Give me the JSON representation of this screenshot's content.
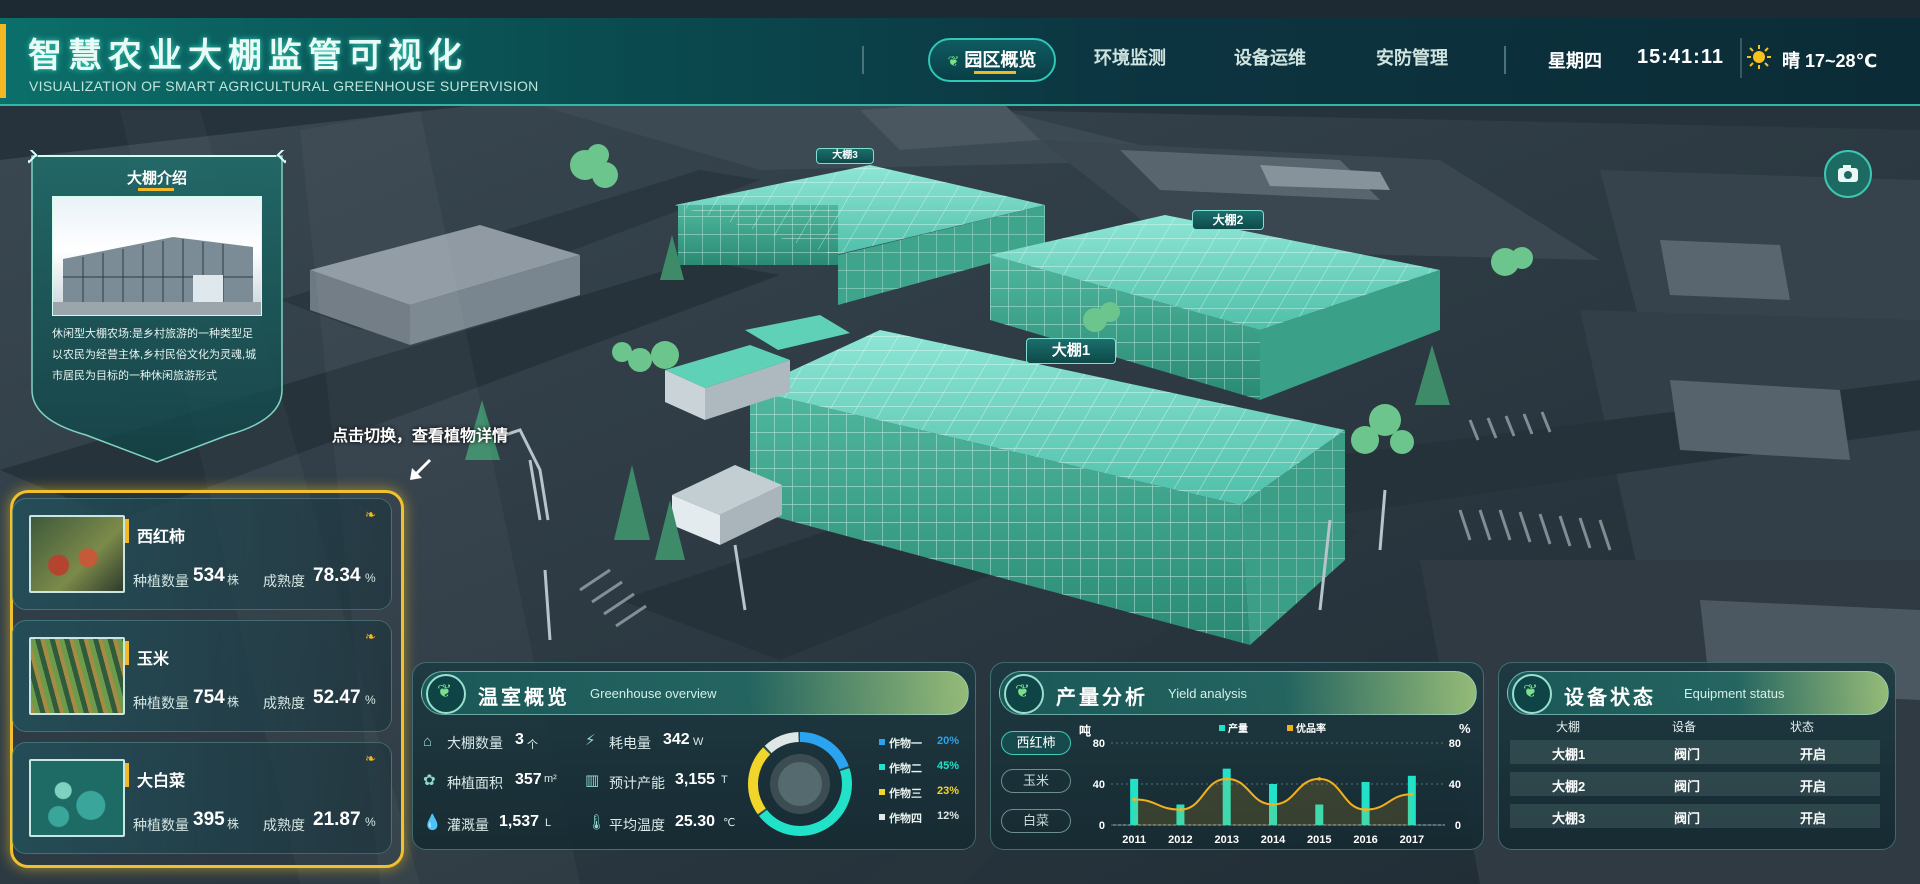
{
  "header": {
    "title": "智慧农业大棚监管可视化",
    "subtitle": "VISUALIZATION OF SMART AGRICULTURAL GREENHOUSE SUPERVISION",
    "nav": [
      {
        "label": "园区概览",
        "active": true
      },
      {
        "label": "环境监测",
        "active": false
      },
      {
        "label": "设备运维",
        "active": false
      },
      {
        "label": "安防管理",
        "active": false
      }
    ],
    "weekday": "星期四",
    "time": "15:41:11",
    "weather": "晴 17~28℃"
  },
  "intro": {
    "title": "大棚介绍",
    "text": "休闲型大棚农场:是乡村旅游的一种类型足以农民为经营主体,乡村民俗文化为灵魂,城市居民为目标的一种休闲旅游形式"
  },
  "hint": "点击切换，查看植物详情",
  "greenhouse_tags": [
    "大棚1",
    "大棚2",
    "大棚3"
  ],
  "crops": [
    {
      "name": "西红柿",
      "count_label": "种植数量",
      "count": "534",
      "count_unit": "株",
      "ripe_label": "成熟度",
      "ripe": "78.34",
      "ripe_unit": "%",
      "colors": [
        "#3e5a3a",
        "#b3452f",
        "#7c8a4a"
      ]
    },
    {
      "name": "玉米",
      "count_label": "种植数量",
      "count": "754",
      "count_unit": "株",
      "ripe_label": "成熟度",
      "ripe": "52.47",
      "ripe_unit": "%",
      "colors": [
        "#2f5a3c",
        "#a58b43",
        "#6d9b4c"
      ]
    },
    {
      "name": "大白菜",
      "count_label": "种植数量",
      "count": "395",
      "count_unit": "株",
      "ripe_label": "成熟度",
      "ripe": "21.87",
      "ripe_unit": "%",
      "colors": [
        "#1e6b66",
        "#3aa59a",
        "#7fd1c1"
      ]
    }
  ],
  "overview": {
    "title": "温室概览",
    "title_en": "Greenhouse overview",
    "stats": [
      {
        "label": "大棚数量",
        "value": "3",
        "unit": "个",
        "icon": "house-icon"
      },
      {
        "label": "耗电量",
        "value": "342",
        "unit": "W",
        "icon": "lightning-icon"
      },
      {
        "label": "种植面积",
        "value": "357",
        "unit": "m²",
        "icon": "sprout-icon"
      },
      {
        "label": "预计产能",
        "value": "3,155",
        "unit": "T",
        "icon": "factory-icon"
      },
      {
        "label": "灌溉量",
        "value": "1,537",
        "unit": "L",
        "icon": "water-drop-icon"
      },
      {
        "label": "平均温度",
        "value": "25.30",
        "unit": "℃",
        "icon": "thermometer-icon"
      }
    ],
    "donut": [
      {
        "name": "作物一",
        "pct": "20%",
        "value": 20,
        "color": "#2aa3f0"
      },
      {
        "name": "作物二",
        "pct": "45%",
        "value": 45,
        "color": "#21e1c8"
      },
      {
        "name": "作物三",
        "pct": "23%",
        "value": 23,
        "color": "#f2d52b"
      },
      {
        "name": "作物四",
        "pct": "12%",
        "value": 12,
        "color": "#dfe7e6"
      }
    ]
  },
  "yield": {
    "title": "产量分析",
    "title_en": "Yield analysis",
    "crop_tabs": [
      {
        "label": "西红柿",
        "active": true
      },
      {
        "label": "玉米",
        "active": false
      },
      {
        "label": "白菜",
        "active": false
      }
    ]
  },
  "chart_data": {
    "type": "bar",
    "categories": [
      "2011",
      "2012",
      "2013",
      "2014",
      "2015",
      "2016",
      "2017"
    ],
    "series": [
      {
        "name": "产量",
        "type": "bar",
        "axis": "left",
        "color": "#21e1c8",
        "values": [
          45,
          20,
          55,
          40,
          20,
          42,
          48
        ]
      },
      {
        "name": "优品率",
        "type": "line",
        "axis": "right",
        "color": "#f2b01e",
        "values": [
          25,
          15,
          45,
          20,
          45,
          15,
          30
        ]
      }
    ],
    "ylabel": "吨",
    "y2label": "%",
    "ylim": [
      0,
      80
    ],
    "y2lim": [
      0,
      80
    ],
    "yticks": [
      "0",
      "40",
      "80"
    ],
    "y2ticks": [
      "0",
      "40",
      "80"
    ],
    "legend_position": "top"
  },
  "equipment": {
    "title": "设备状态",
    "title_en": "Equipment status",
    "columns": [
      "大棚",
      "设备",
      "状态"
    ],
    "rows": [
      [
        "大棚1",
        "阀门",
        "开启"
      ],
      [
        "大棚2",
        "阀门",
        "开启"
      ],
      [
        "大棚3",
        "阀门",
        "开启"
      ]
    ]
  }
}
